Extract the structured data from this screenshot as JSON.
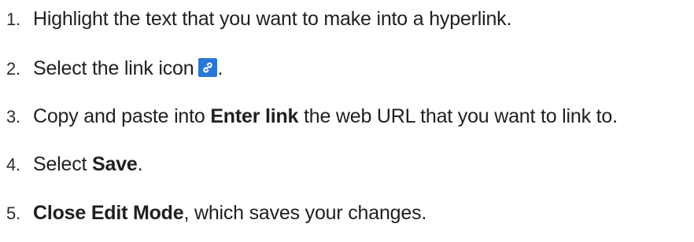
{
  "steps": [
    {
      "number": "1.",
      "text": "Highlight the text that you want to make into a hyperlink."
    },
    {
      "number": "2.",
      "before": "Select the link icon",
      "icon": "link-icon",
      "after": "."
    },
    {
      "number": "3.",
      "before": "Copy and paste into ",
      "bold": "Enter link",
      "after": " the web URL that you want to link to."
    },
    {
      "number": "4.",
      "before": "Select ",
      "bold": "Save",
      "after": "."
    },
    {
      "number": "5.",
      "bold": "Close Edit Mode",
      "after": ", which saves your changes."
    }
  ],
  "colors": {
    "icon_background": "#2878d6",
    "icon_glyph": "#ffffff"
  }
}
